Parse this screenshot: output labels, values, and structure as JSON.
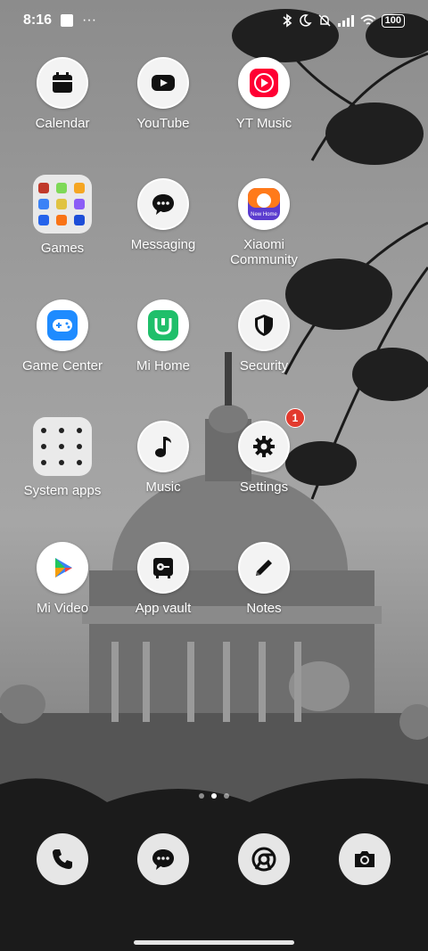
{
  "status_bar": {
    "time": "8:16",
    "more_indicator": "···",
    "battery": "100",
    "icons": [
      "bluetooth-icon",
      "do-not-disturb-icon",
      "silent-icon",
      "signal-icon",
      "wifi-icon",
      "battery-icon"
    ]
  },
  "apps": [
    {
      "label": "Calendar",
      "icon": "calendar-icon"
    },
    {
      "label": "YouTube",
      "icon": "youtube-icon"
    },
    {
      "label": "YT Music",
      "icon": "yt-music-icon"
    },
    {
      "label": "Games",
      "icon": "folder-icon"
    },
    {
      "label": "Messaging",
      "icon": "messaging-icon"
    },
    {
      "label": "Xiaomi Community",
      "icon": "xiaomi-community-icon"
    },
    {
      "label": "Game Center",
      "icon": "game-center-icon"
    },
    {
      "label": "Mi Home",
      "icon": "mi-home-icon"
    },
    {
      "label": "Security",
      "icon": "shield-icon"
    },
    {
      "label": "System apps",
      "icon": "folder-icon"
    },
    {
      "label": "Music",
      "icon": "music-note-icon"
    },
    {
      "label": "Settings",
      "icon": "gear-icon",
      "badge": "1"
    },
    {
      "label": "Mi Video",
      "icon": "mi-video-icon"
    },
    {
      "label": "App vault",
      "icon": "app-vault-icon"
    },
    {
      "label": "Notes",
      "icon": "pencil-icon"
    }
  ],
  "xiaomi_community_caption": "New Home",
  "page_indicator": {
    "pages": 3,
    "current": 2
  },
  "dock": [
    "phone-icon",
    "messaging-icon",
    "chrome-icon",
    "camera-icon"
  ],
  "colors": {
    "badge": "#e23a2e",
    "icon_bg": "#f3f3f3",
    "yt_red": "#ff0000",
    "mi_home_green": "#1fbf6a",
    "game_center_blue": "#1e8bff"
  }
}
